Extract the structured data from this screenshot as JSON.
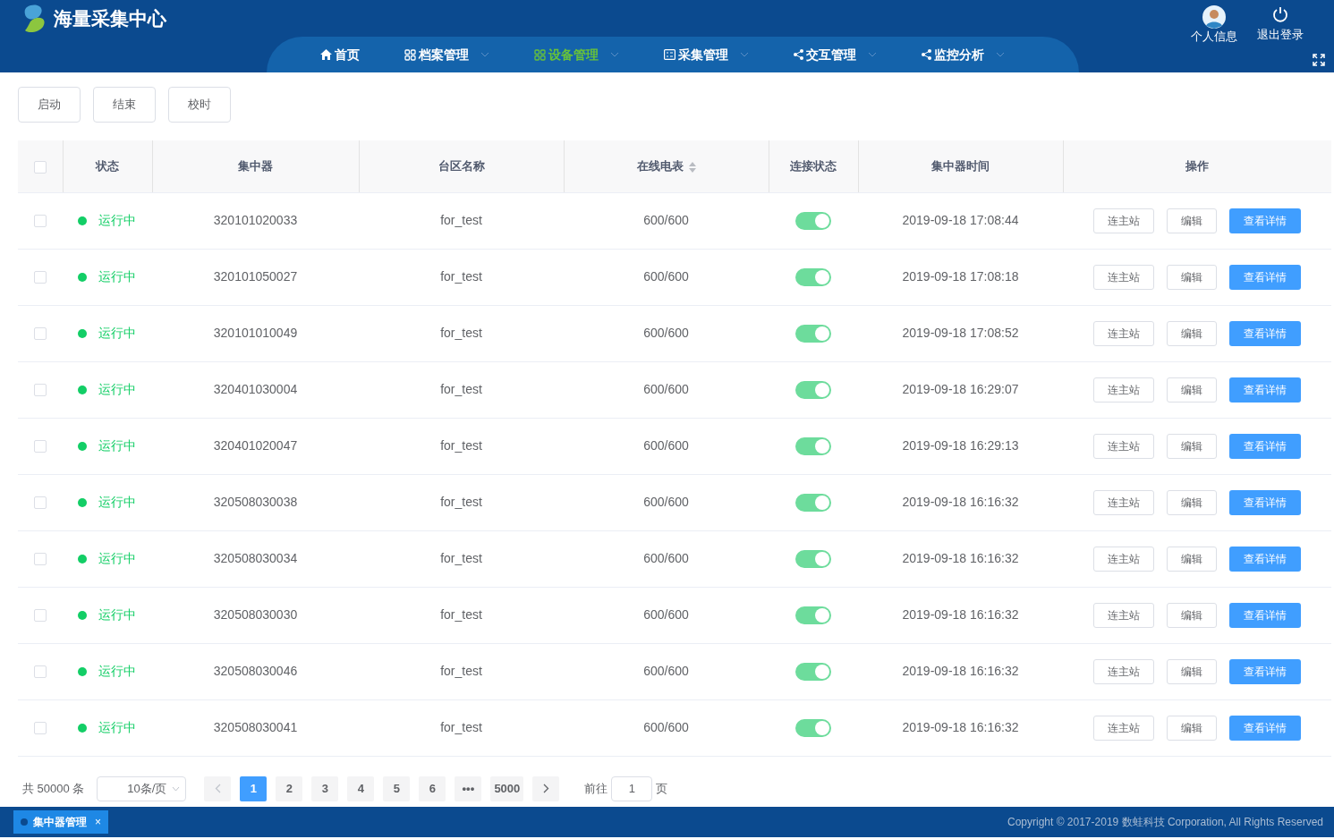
{
  "header": {
    "title": "海量采集中心",
    "nav": [
      {
        "label": "首页",
        "kind": "home",
        "dropdown": false,
        "selected": false
      },
      {
        "label": "档案管理",
        "kind": "grid",
        "dropdown": true,
        "selected": false
      },
      {
        "label": "设备管理",
        "kind": "grid",
        "dropdown": true,
        "selected": true
      },
      {
        "label": "采集管理",
        "kind": "form",
        "dropdown": true,
        "selected": false
      },
      {
        "label": "交互管理",
        "kind": "share",
        "dropdown": true,
        "selected": false
      },
      {
        "label": "监控分析",
        "kind": "share",
        "dropdown": true,
        "selected": false
      }
    ],
    "user_label": "个人信息",
    "logout_label": "退出登录"
  },
  "toolbar": [
    "启动",
    "结束",
    "校时"
  ],
  "table": {
    "all_checked": false,
    "columns": [
      {
        "label": "状态",
        "sortable": false
      },
      {
        "label": "集中器",
        "sortable": false
      },
      {
        "label": "台区名称",
        "sortable": false
      },
      {
        "label": "在线电表",
        "sortable": true
      },
      {
        "label": "连接状态",
        "sortable": false
      },
      {
        "label": "集中器时间",
        "sortable": false
      },
      {
        "label": "操作",
        "sortable": false
      }
    ],
    "rows": [
      {
        "checked": false,
        "status": "运行中",
        "running": true,
        "concentrator": "320101020033",
        "area": "for_test",
        "online": "600/600",
        "connected": true,
        "time": "2019-09-18 17:08:44",
        "actions": [
          "连主站",
          "编辑",
          "查看详情"
        ]
      },
      {
        "checked": false,
        "status": "运行中",
        "running": true,
        "concentrator": "320101050027",
        "area": "for_test",
        "online": "600/600",
        "connected": true,
        "time": "2019-09-18 17:08:18",
        "actions": [
          "连主站",
          "编辑",
          "查看详情"
        ]
      },
      {
        "checked": false,
        "status": "运行中",
        "running": true,
        "concentrator": "320101010049",
        "area": "for_test",
        "online": "600/600",
        "connected": true,
        "time": "2019-09-18 17:08:52",
        "actions": [
          "连主站",
          "编辑",
          "查看详情"
        ]
      },
      {
        "checked": false,
        "status": "运行中",
        "running": true,
        "concentrator": "320401030004",
        "area": "for_test",
        "online": "600/600",
        "connected": true,
        "time": "2019-09-18 16:29:07",
        "actions": [
          "连主站",
          "编辑",
          "查看详情"
        ]
      },
      {
        "checked": false,
        "status": "运行中",
        "running": true,
        "concentrator": "320401020047",
        "area": "for_test",
        "online": "600/600",
        "connected": true,
        "time": "2019-09-18 16:29:13",
        "actions": [
          "连主站",
          "编辑",
          "查看详情"
        ]
      },
      {
        "checked": false,
        "status": "运行中",
        "running": true,
        "concentrator": "320508030038",
        "area": "for_test",
        "online": "600/600",
        "connected": true,
        "time": "2019-09-18 16:16:32",
        "actions": [
          "连主站",
          "编辑",
          "查看详情"
        ]
      },
      {
        "checked": false,
        "status": "运行中",
        "running": true,
        "concentrator": "320508030034",
        "area": "for_test",
        "online": "600/600",
        "connected": true,
        "time": "2019-09-18 16:16:32",
        "actions": [
          "连主站",
          "编辑",
          "查看详情"
        ]
      },
      {
        "checked": false,
        "status": "运行中",
        "running": true,
        "concentrator": "320508030030",
        "area": "for_test",
        "online": "600/600",
        "connected": true,
        "time": "2019-09-18 16:16:32",
        "actions": [
          "连主站",
          "编辑",
          "查看详情"
        ]
      },
      {
        "checked": false,
        "status": "运行中",
        "running": true,
        "concentrator": "320508030046",
        "area": "for_test",
        "online": "600/600",
        "connected": true,
        "time": "2019-09-18 16:16:32",
        "actions": [
          "连主站",
          "编辑",
          "查看详情"
        ]
      },
      {
        "checked": false,
        "status": "运行中",
        "running": true,
        "concentrator": "320508030041",
        "area": "for_test",
        "online": "600/600",
        "connected": true,
        "time": "2019-09-18 16:16:32",
        "actions": [
          "连主站",
          "编辑",
          "查看详情"
        ]
      }
    ]
  },
  "pagination": {
    "total": "共 50000 条",
    "page_size": "10条/页",
    "pages": [
      {
        "label": "1",
        "selected": true
      },
      {
        "label": "2",
        "selected": false
      },
      {
        "label": "3",
        "selected": false
      },
      {
        "label": "4",
        "selected": false
      },
      {
        "label": "5",
        "selected": false
      },
      {
        "label": "6",
        "selected": false
      },
      {
        "label": "•••",
        "selected": false
      },
      {
        "label": "5000",
        "selected": false
      }
    ],
    "goto_label": "前往",
    "goto_value": "1",
    "page_suffix": "页"
  },
  "footer": {
    "tabs": [
      {
        "label": "集中器管理",
        "close": "×",
        "selected": true
      }
    ],
    "copyright": "Copyright © 2017-2019 数蛙科技 Corporation, All Rights Reserved"
  }
}
